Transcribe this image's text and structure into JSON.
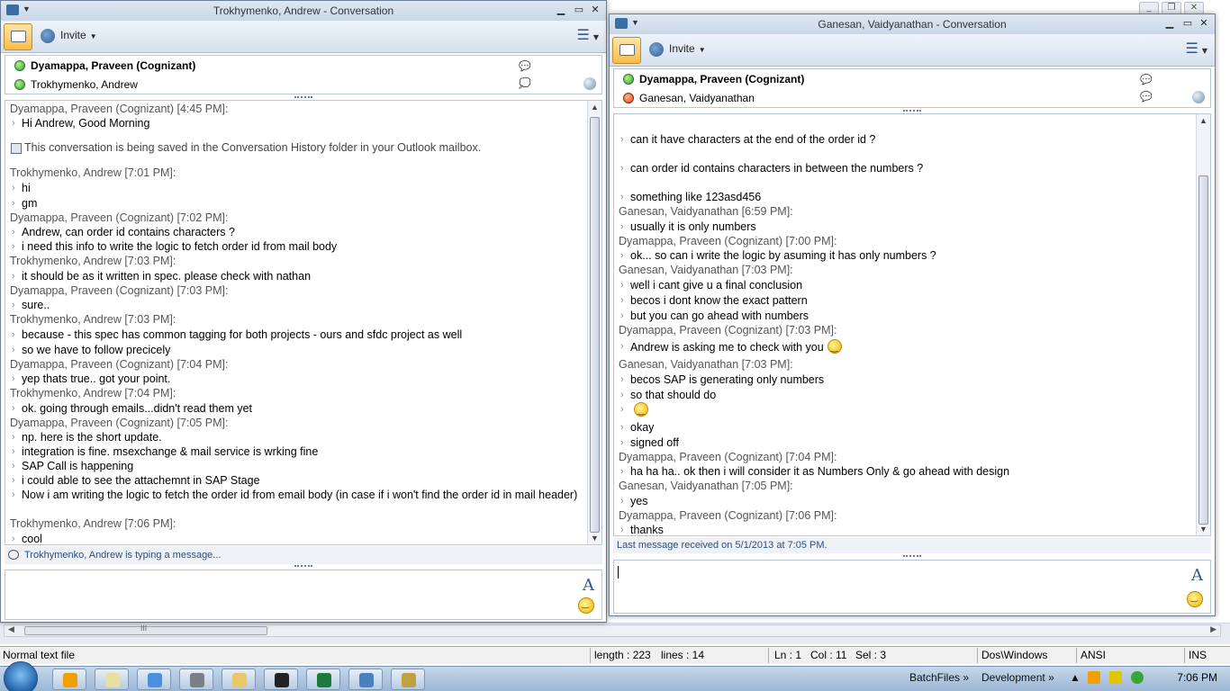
{
  "editor": {
    "status_filetype": "Normal text file",
    "status_length": "length : 223",
    "status_lines": "lines : 14",
    "status_ln": "Ln : 1",
    "status_col": "Col : 11",
    "status_sel": "Sel : 3",
    "status_eol": "Dos\\Windows",
    "status_enc": "ANSI",
    "status_mode": "INS",
    "scroll_thumb": "III"
  },
  "left": {
    "title": "Trokhymenko, Andrew - Conversation",
    "invite_label": "Invite",
    "participants": [
      {
        "name": "Dyamappa, Praveen (Cognizant)",
        "status": "available"
      },
      {
        "name": "Trokhymenko, Andrew",
        "status": "available"
      }
    ],
    "messages": [
      {
        "kind": "hdr",
        "text": "Dyamappa, Praveen (Cognizant) [4:45 PM]:"
      },
      {
        "kind": "msg",
        "text": "Hi Andrew, Good Morning"
      },
      {
        "kind": "info",
        "text": "This conversation is being saved in the Conversation History folder in your Outlook mailbox."
      },
      {
        "kind": "hdr",
        "text": "Trokhymenko, Andrew [7:01 PM]:"
      },
      {
        "kind": "msg",
        "text": "hi"
      },
      {
        "kind": "msg",
        "text": "gm"
      },
      {
        "kind": "hdr",
        "text": "Dyamappa, Praveen (Cognizant) [7:02 PM]:"
      },
      {
        "kind": "msg",
        "text": "Andrew, can order id contains characters ?"
      },
      {
        "kind": "msg",
        "text": "i need this info to write the logic to fetch order id from mail body"
      },
      {
        "kind": "hdr",
        "text": "Trokhymenko, Andrew [7:03 PM]:"
      },
      {
        "kind": "msg",
        "text": "it should be as it written in spec. please check with nathan"
      },
      {
        "kind": "hdr",
        "text": "Dyamappa, Praveen (Cognizant) [7:03 PM]:"
      },
      {
        "kind": "msg",
        "text": "sure.."
      },
      {
        "kind": "hdr",
        "text": "Trokhymenko, Andrew [7:03 PM]:"
      },
      {
        "kind": "msg",
        "text": "because - this spec has common tagging for both projects - ours and sfdc project as well"
      },
      {
        "kind": "msg",
        "text": "so we have to follow precicely"
      },
      {
        "kind": "hdr",
        "text": "Dyamappa, Praveen (Cognizant) [7:04 PM]:"
      },
      {
        "kind": "msg",
        "text": "yep thats true.. got your point."
      },
      {
        "kind": "hdr",
        "text": "Trokhymenko, Andrew [7:04 PM]:"
      },
      {
        "kind": "msg",
        "text": "ok. going through emails...didn't read them yet"
      },
      {
        "kind": "hdr",
        "text": "Dyamappa, Praveen (Cognizant) [7:05 PM]:"
      },
      {
        "kind": "msg",
        "text": "np. here is the short update."
      },
      {
        "kind": "msg",
        "text": "integration is fine. msexchange & mail service is wrking fine"
      },
      {
        "kind": "msg",
        "text": "SAP Call is happening"
      },
      {
        "kind": "msg",
        "text": "i could able to see the attachemnt in SAP Stage"
      },
      {
        "kind": "msg",
        "text": "Now i am writing the logic to fetch the order id from email body (in case if i won't find the order id in mail header)"
      },
      {
        "kind": "hdr",
        "text": "Trokhymenko, Andrew [7:06 PM]:"
      },
      {
        "kind": "msg",
        "text": "cool"
      }
    ],
    "typing_status": "Trokhymenko, Andrew is typing a message..."
  },
  "right": {
    "title": "Ganesan, Vaidyanathan - Conversation",
    "invite_label": "Invite",
    "participants": [
      {
        "name": "Dyamappa, Praveen (Cognizant)",
        "status": "available"
      },
      {
        "name": "Ganesan, Vaidyanathan",
        "status": "busy"
      }
    ],
    "messages": [
      {
        "kind": "msg",
        "text": "can it have characters at the end of the order id ?"
      },
      {
        "kind": "msg",
        "text": "can order id contains characters in between the numbers ?"
      },
      {
        "kind": "msg",
        "text": "something like 123asd456"
      },
      {
        "kind": "hdr",
        "text": "Ganesan, Vaidyanathan [6:59 PM]:"
      },
      {
        "kind": "msg",
        "text": "usually it is only numbers"
      },
      {
        "kind": "hdr",
        "text": "Dyamappa, Praveen (Cognizant) [7:00 PM]:"
      },
      {
        "kind": "msg",
        "text": "ok... so can i write the logic by asuming it has only numbers ?"
      },
      {
        "kind": "hdr",
        "text": "Ganesan, Vaidyanathan [7:03 PM]:"
      },
      {
        "kind": "msg",
        "text": "well i cant give u a final conclusion"
      },
      {
        "kind": "msg",
        "text": "becos i dont know the exact pattern"
      },
      {
        "kind": "msg",
        "text": "but you can go ahead with numbers"
      },
      {
        "kind": "hdr",
        "text": "Dyamappa, Praveen (Cognizant) [7:03 PM]:"
      },
      {
        "kind": "msg",
        "text": "Andrew is asking me to check with you",
        "emoticon": true
      },
      {
        "kind": "hdr",
        "text": "Ganesan, Vaidyanathan [7:03 PM]:"
      },
      {
        "kind": "msg",
        "text": "becos SAP is generating only numbers"
      },
      {
        "kind": "msg",
        "text": "so that should do"
      },
      {
        "kind": "msg",
        "text": "",
        "emoticon": true
      },
      {
        "kind": "msg",
        "text": "okay"
      },
      {
        "kind": "msg",
        "text": "signed off"
      },
      {
        "kind": "hdr",
        "text": "Dyamappa, Praveen (Cognizant) [7:04 PM]:"
      },
      {
        "kind": "msg",
        "text": "ha ha ha.. ok then i will consider it as Numbers Only & go ahead with design"
      },
      {
        "kind": "hdr",
        "text": "Ganesan, Vaidyanathan [7:05 PM]:"
      },
      {
        "kind": "msg",
        "text": "yes"
      },
      {
        "kind": "hdr",
        "text": "Dyamappa, Praveen (Cognizant) [7:06 PM]:"
      },
      {
        "kind": "msg",
        "text": "thanks"
      }
    ],
    "last_received": "Last message received on 5/1/2013 at 7:05 PM."
  },
  "taskbar": {
    "apps": [
      "outlook-icon",
      "notepad-icon",
      "chrome-icon",
      "settings-icon",
      "explorer-icon",
      "cmd-icon",
      "excel-icon",
      "communicator-icon",
      "folder-icon"
    ],
    "tray_batchfiles": "BatchFiles",
    "tray_development": "Development",
    "clock": "7:06 PM"
  },
  "colors": {
    "accent": "#3a6ea5",
    "status_available": "#2ea82e",
    "status_busy": "#d8481a",
    "header_text": "#555555"
  }
}
